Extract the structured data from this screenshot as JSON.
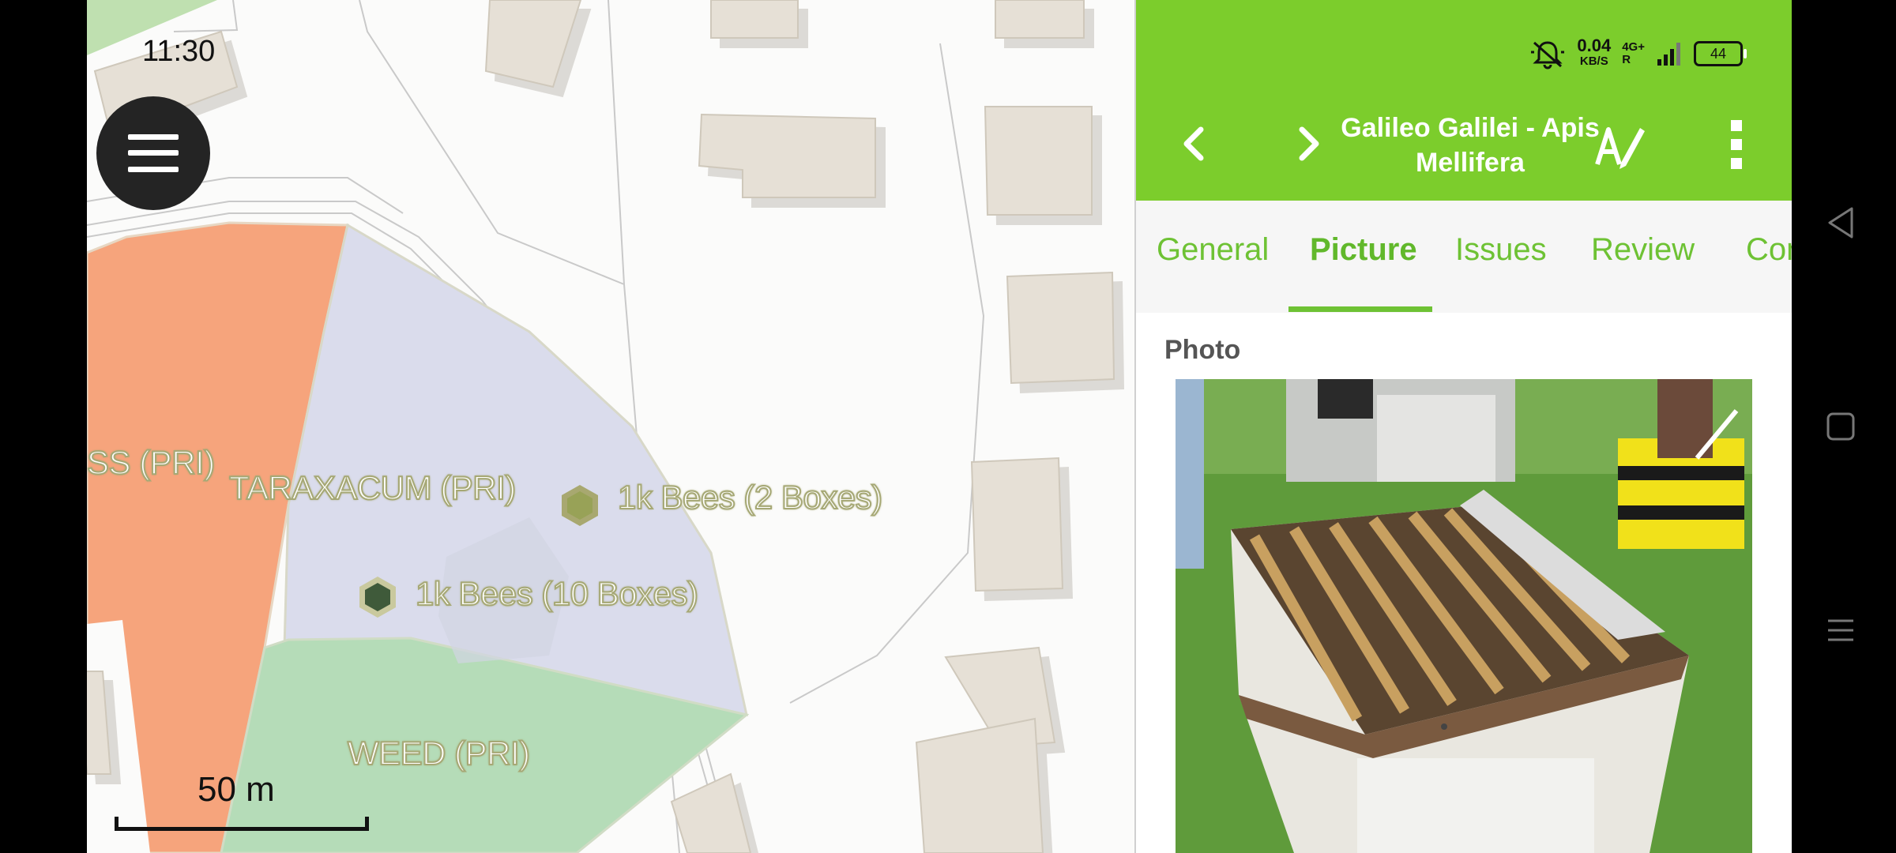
{
  "status_bar": {
    "time": "11:30",
    "net_speed": "0.04",
    "net_unit": "KB/S",
    "network": "4G+",
    "roaming": "R",
    "battery": "44"
  },
  "map": {
    "labels": {
      "grass": "SS (PRI)",
      "taraxacum": "TARAXACUM (PRI)",
      "weed": "WEED (PRI)",
      "bees_2": "1k Bees (2 Boxes)",
      "bees_10": "1k Bees (10 Boxes)"
    },
    "scale": "50 m",
    "colors": {
      "orange_area": "#f6a47c",
      "blue_area": "#dadcec",
      "green_area": "#b5dcb8",
      "buildings": "#e6e0d6"
    }
  },
  "panel": {
    "title": "Galileo Galilei - Apis Mellifera",
    "tabs": [
      "General",
      "Picture",
      "Issues",
      "Review",
      "Con"
    ],
    "active_tab": "Picture",
    "photo_label": "Photo",
    "accent": "#7ccd2c"
  },
  "icons": [
    "hamburger-menu-icon",
    "chevron-left-icon",
    "chevron-right-icon",
    "edit-pen-icon",
    "more-vert-icon",
    "bell-muted-icon",
    "signal-icon",
    "battery-icon",
    "nav-back-icon",
    "nav-home-icon",
    "nav-recents-icon",
    "hexagon-marker-icon"
  ]
}
